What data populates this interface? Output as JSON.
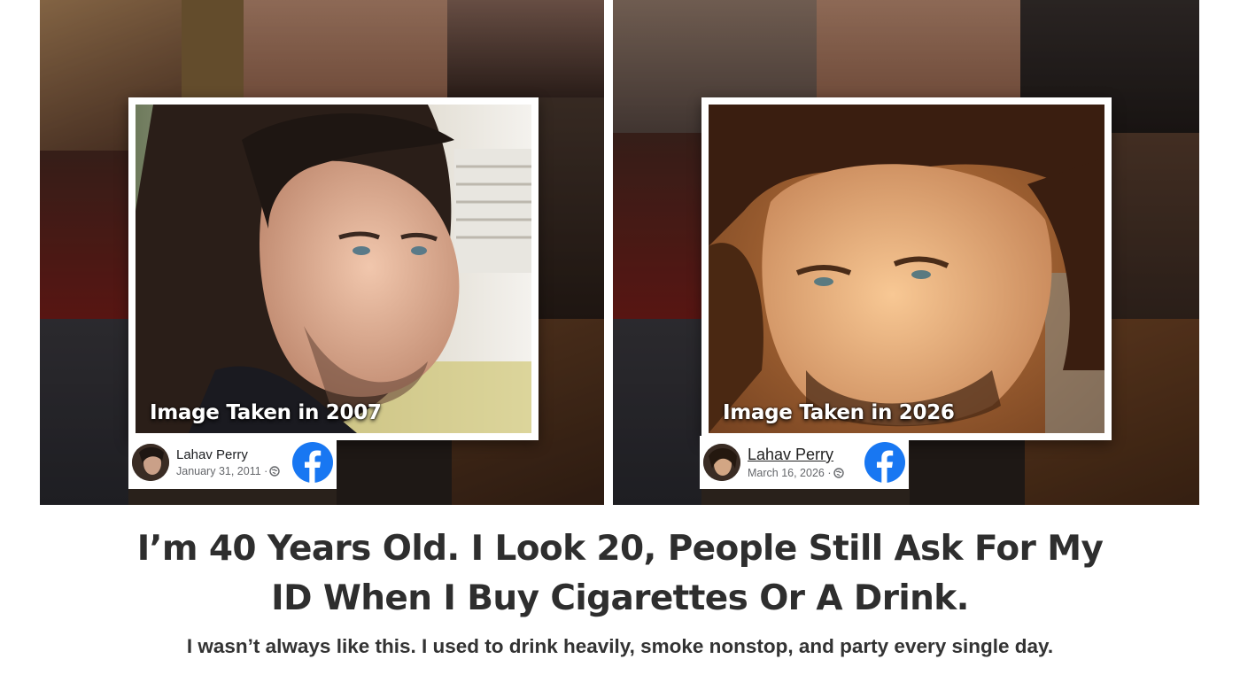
{
  "left_post": {
    "caption": "Image Taken in 2007",
    "author": "Lahav Perry",
    "date": "January 31, 2011 ·"
  },
  "right_post": {
    "caption": "Image Taken in 2026",
    "author": "Lahav Perry",
    "date": "March 16, 2026 ·"
  },
  "headline": {
    "line1": "I’m 40 Years Old. I Look 20, People Still Ask For My",
    "line2": "ID When I Buy Cigarettes Or A Drink."
  },
  "subheadline": "I wasn’t always like this. I used to drink heavily, smoke nonstop, and party every single day.",
  "icons": {
    "facebook": "facebook-logo-icon",
    "globe": "public-globe-icon"
  },
  "colors": {
    "facebook_blue": "#1877F2",
    "headline_text": "#2E2E2E"
  }
}
